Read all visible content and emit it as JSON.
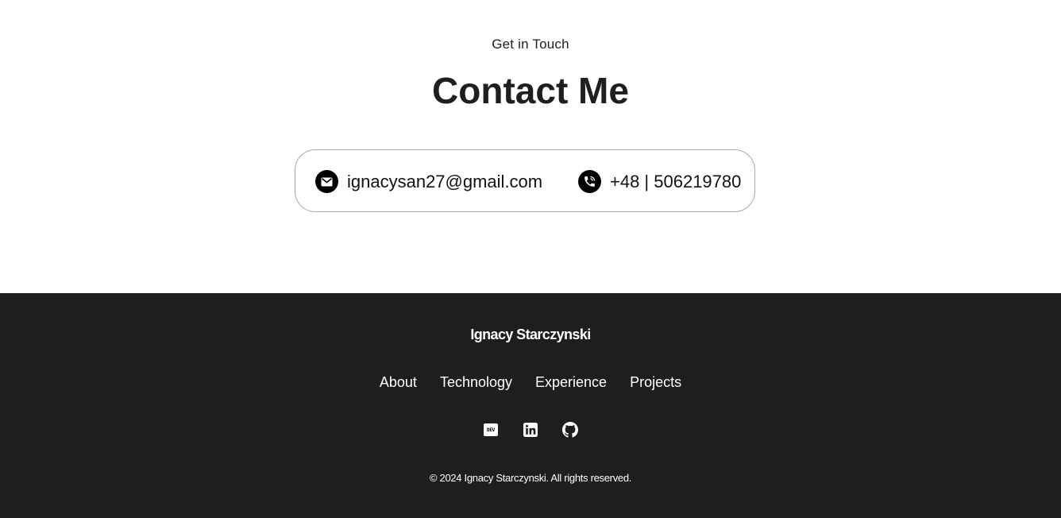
{
  "contact": {
    "eyebrow": "Get in Touch",
    "title": "Contact Me",
    "email": "ignacysan27@gmail.com",
    "phone": "+48 | 506219780"
  },
  "footer": {
    "name": "Ignacy Starczynski",
    "nav": [
      {
        "label": "About"
      },
      {
        "label": "Technology"
      },
      {
        "label": "Experience"
      },
      {
        "label": "Projects"
      }
    ],
    "social": [
      {
        "icon": "dev-icon",
        "text": "DEV"
      },
      {
        "icon": "linkedin-icon"
      },
      {
        "icon": "github-icon"
      }
    ],
    "copyright": "© 2024 Ignacy Starczynski. All rights reserved."
  },
  "colors": {
    "footer_bg": "#1e1e1e",
    "text_dark": "#1f1f1f",
    "card_border": "#a9a9a9"
  }
}
